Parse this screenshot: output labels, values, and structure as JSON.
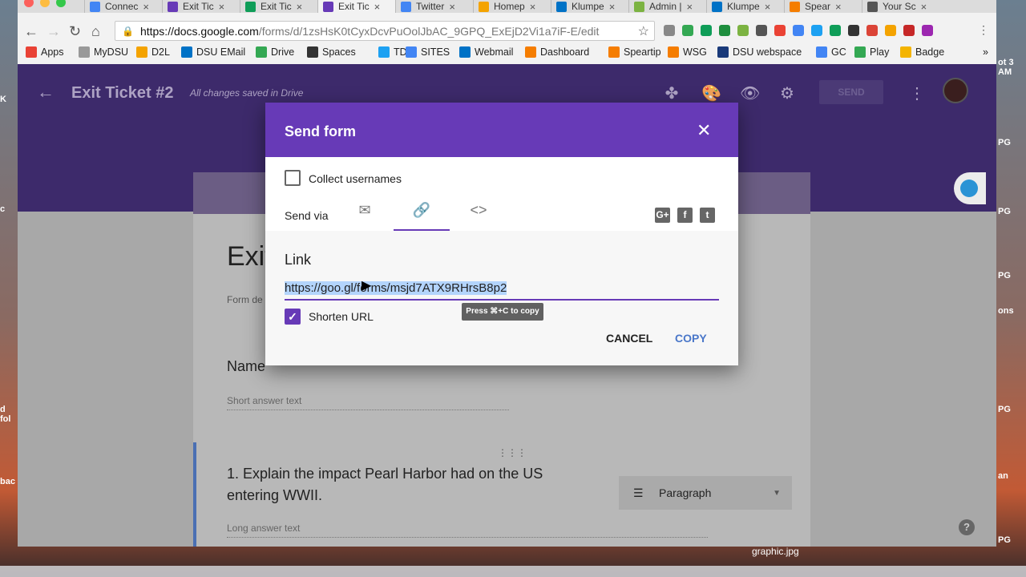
{
  "browser": {
    "tabs": [
      {
        "label": "Connec",
        "icon": "drive-icon",
        "color": "#4285f4"
      },
      {
        "label": "Exit Tic",
        "icon": "forms-icon",
        "color": "#673ab7"
      },
      {
        "label": "Exit Tic",
        "icon": "sheets-icon",
        "color": "#0f9d58"
      },
      {
        "label": "Exit Tic",
        "icon": "forms-icon",
        "color": "#673ab7",
        "active": true
      },
      {
        "label": "Twitter",
        "icon": "docs-icon",
        "color": "#4285f4"
      },
      {
        "label": "Homep",
        "icon": "star-icon",
        "color": "#f4a300"
      },
      {
        "label": "Klumpe",
        "icon": "outlook-icon",
        "color": "#0072c6"
      },
      {
        "label": "Admin |",
        "icon": "key-icon",
        "color": "#7cb342"
      },
      {
        "label": "Klumpe",
        "icon": "outlook-icon",
        "color": "#0072c6"
      },
      {
        "label": "Spear",
        "icon": "blogger-icon",
        "color": "#f57d00"
      },
      {
        "label": "Your Sc",
        "icon": "page-icon",
        "color": "#555"
      }
    ],
    "url_host": "https://docs.google.com",
    "url_path": "/forms/d/1zsHsK0tCyxDcvPuOolJbAC_9GPQ_ExEjD2Vi1a7iF-E/edit",
    "bookmarks": [
      {
        "label": "Apps",
        "icon": "apps-icon",
        "color": "#e94235"
      },
      {
        "label": "MyDSU",
        "icon": "page-icon",
        "color": "#999"
      },
      {
        "label": "D2L",
        "icon": "d2l-icon",
        "color": "#f4a300"
      },
      {
        "label": "DSU EMail",
        "icon": "outlook-icon",
        "color": "#0072c6"
      },
      {
        "label": "Drive",
        "icon": "drive-icon",
        "color": "#34a853"
      },
      {
        "label": "Spaces",
        "icon": "spaces-icon",
        "color": "#333"
      },
      {
        "label": "TD",
        "icon": "twitter-icon",
        "color": "#1da1f2"
      },
      {
        "label": "SITES",
        "icon": "sites-icon",
        "color": "#4285f4"
      },
      {
        "label": "Webmail",
        "icon": "outlook-icon",
        "color": "#0072c6"
      },
      {
        "label": "Dashboard",
        "icon": "blogger-icon",
        "color": "#f57d00"
      },
      {
        "label": "Speartip",
        "icon": "blogger-icon",
        "color": "#f57d00"
      },
      {
        "label": "WSG",
        "icon": "blogger-icon",
        "color": "#f57d00"
      },
      {
        "label": "DSU webspace",
        "icon": "dsu-icon",
        "color": "#1a3a7a"
      },
      {
        "label": "GC",
        "icon": "google-icon",
        "color": "#4285f4"
      },
      {
        "label": "Play",
        "icon": "play-icon",
        "color": "#34a853"
      },
      {
        "label": "Badge",
        "icon": "badge-icon",
        "color": "#f4b400"
      }
    ]
  },
  "form": {
    "title": "Exit Ticket #2",
    "saved_status": "All changes saved in Drive",
    "send_label": "SEND",
    "form_title_partial": "Exit",
    "form_desc_partial": "Form de",
    "name_question": "Name",
    "short_answer": "Short answer text",
    "question1": "1. Explain the impact Pearl Harbor had on the US entering WWII.",
    "question1_type": "Paragraph",
    "long_answer": "Long answer text",
    "accent": "#673ab7"
  },
  "dialog": {
    "title": "Send form",
    "collect_usernames": "Collect usernames",
    "send_via": "Send via",
    "link_heading": "Link",
    "link_url": "https://goo.gl/forms/msjd7ATX9RHrsB8p2",
    "shorten_url": "Shorten URL",
    "tooltip": "Press ⌘+C to copy",
    "cancel": "CANCEL",
    "copy": "COPY",
    "social": [
      "G+",
      "f",
      "t"
    ]
  },
  "desktop": {
    "file_label": "graphic.jpg",
    "left_snips": [
      "K",
      "c",
      "d fol",
      "bac"
    ],
    "right_snips": [
      "ot 3 AM",
      "PG",
      "PG",
      "PG",
      "ons",
      "PG",
      "an",
      "PG"
    ]
  }
}
